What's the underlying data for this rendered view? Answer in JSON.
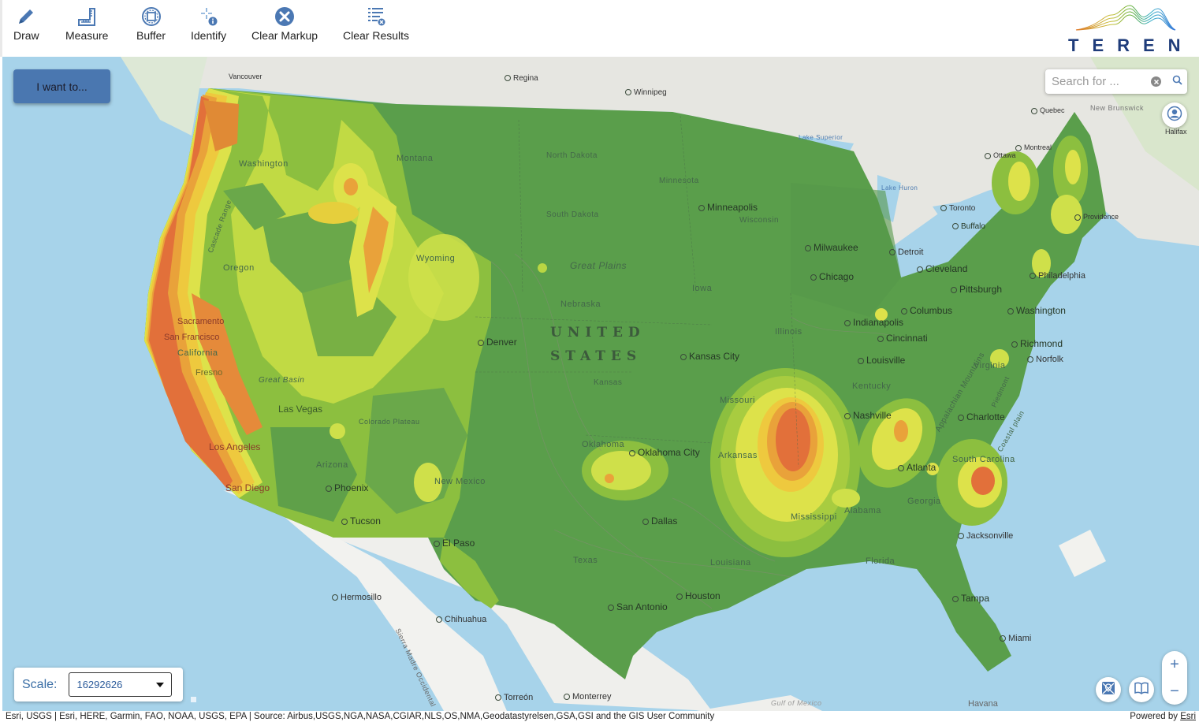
{
  "toolbar": {
    "tools": [
      {
        "label": "Draw",
        "icon": "pencil-icon",
        "has_menu": true
      },
      {
        "label": "Measure",
        "icon": "ruler-icon",
        "has_menu": true
      },
      {
        "label": "Buffer",
        "icon": "buffer-icon",
        "has_menu": true
      },
      {
        "label": "Identify",
        "icon": "identify-icon",
        "has_menu": false
      },
      {
        "label": "Clear Markup",
        "icon": "close-circle-icon",
        "has_menu": false
      },
      {
        "label": "Clear Results",
        "icon": "clear-list-icon",
        "has_menu": false
      }
    ]
  },
  "logo": {
    "text": "TEREN",
    "colors": [
      "#e07a2a",
      "#7ab52a",
      "#3a9ad9"
    ]
  },
  "i_want_to": {
    "label": "I want to..."
  },
  "search": {
    "placeholder": "Search for ...",
    "value": ""
  },
  "scale": {
    "label": "Scale:",
    "value": "16292626"
  },
  "zoom": {
    "in": "+",
    "out": "−"
  },
  "colors": {
    "accent": "#4a77b0",
    "ocean": "#a7d3ea",
    "land_canada": "#e6e6e1",
    "hazard_low": "#5a9e4b",
    "hazard_mid_low": "#8cbf3f",
    "hazard_mid": "#d4e24a",
    "hazard_mid_high": "#f0d840",
    "hazard_high": "#e9a23a",
    "hazard_very_high": "#e2703a"
  },
  "map": {
    "country_label": [
      "UNITED",
      "STATES"
    ],
    "cities": [
      "Vancouver",
      "Regina",
      "Winnipeg",
      "Minneapolis",
      "Milwaukee",
      "Chicago",
      "Detroit",
      "Toronto",
      "Buffalo",
      "Ottawa",
      "Montreal",
      "Quebec",
      "Cleveland",
      "Pittsburgh",
      "Philadelphia",
      "Providence",
      "Washington",
      "Richmond",
      "Norfolk",
      "Indianapolis",
      "Columbus",
      "Cincinnati",
      "Louisville",
      "Nashville",
      "Charlotte",
      "Atlanta",
      "Jacksonville",
      "Tampa",
      "Miami",
      "Havana",
      "Kansas City",
      "Denver",
      "Oklahoma City",
      "Dallas",
      "Houston",
      "San Antonio",
      "El Paso",
      "Phoenix",
      "Tucson",
      "Las Vegas",
      "Los Angeles",
      "San Diego",
      "Sacramento",
      "San Francisco",
      "Fresno",
      "Hermosillo",
      "Chihuahua",
      "Torreón",
      "Monterrey",
      "Halifax"
    ],
    "regions": [
      "Montana",
      "North Dakota",
      "South Dakota",
      "Minnesota",
      "Wisconsin",
      "Iowa",
      "Nebraska",
      "Kansas",
      "Illinois",
      "Missouri",
      "Kentucky",
      "Oklahoma",
      "Texas",
      "Louisiana",
      "Mississippi",
      "Alabama",
      "Georgia",
      "Florida",
      "Arkansas",
      "Arizona",
      "New Mexico",
      "Wyoming",
      "Oregon",
      "Washington",
      "California",
      "Virginia",
      "South Carolina",
      "New Brunswick",
      "Great Plains",
      "Colorado Plateau",
      "Great Basin",
      "Appalachian Mountains",
      "Lake Superior",
      "Lake Huron",
      "Gulf of Mexico",
      "Sierra Madre Occidental",
      "Cascade Range",
      "Piedmont",
      "Coastal plain"
    ]
  },
  "attribution": {
    "text": "Esri, USGS | Esri, HERE, Garmin, FAO, NOAA, USGS, EPA | Source: Airbus,USGS,NGA,NASA,CGIAR,NLS,OS,NMA,Geodatastyrelsen,GSA,GSI and the GIS User Community",
    "powered_prefix": "Powered by ",
    "powered_link": "Esri"
  }
}
